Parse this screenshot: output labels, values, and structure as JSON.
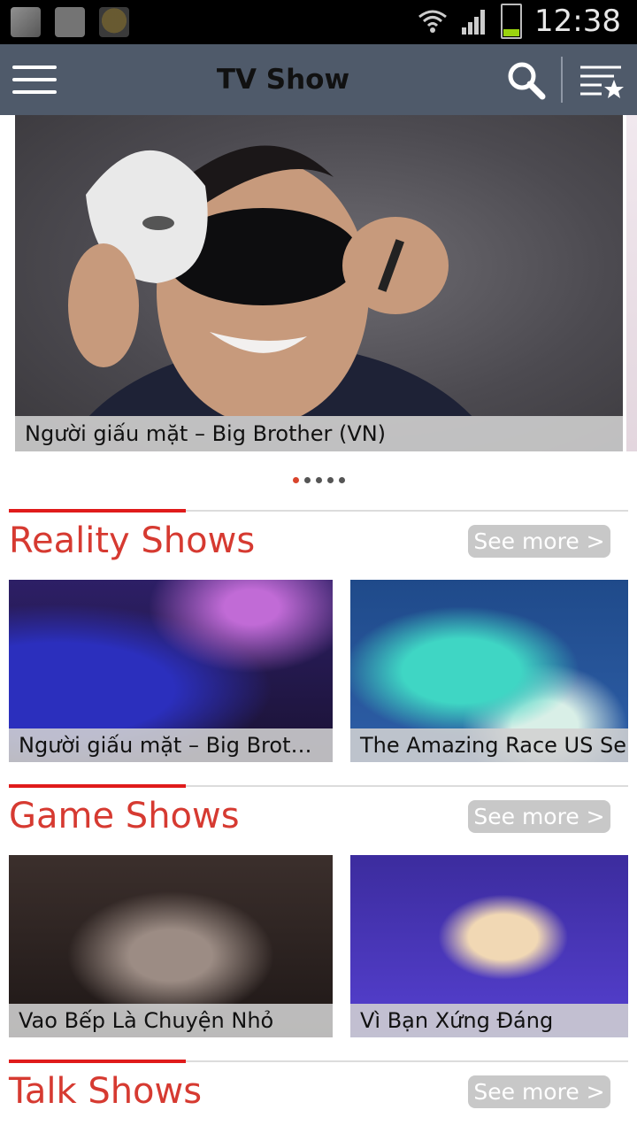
{
  "status_bar": {
    "time": "12:38"
  },
  "app_bar": {
    "title": "TV Show"
  },
  "featured": {
    "caption": "Người giấu mặt – Big Brother (VN)",
    "dot_count": 5,
    "active_index": 0
  },
  "sections": [
    {
      "title": "Reality Shows",
      "see_more": "See more >",
      "items": [
        {
          "caption": "Người giấu mặt – Big Brot…"
        },
        {
          "caption": "The Amazing Race US Se"
        }
      ]
    },
    {
      "title": "Game Shows",
      "see_more": "See more >",
      "items": [
        {
          "caption": "Vao Bếp Là Chuyện Nhỏ"
        },
        {
          "caption": "Vì Bạn Xứng Đáng"
        }
      ]
    },
    {
      "title": "Talk Shows",
      "see_more": "See more >",
      "items": []
    }
  ],
  "colors": {
    "app_bar": "#4f5a6a",
    "section_title": "#d63a31",
    "accent_rule": "#e01b1b",
    "see_more_bg": "#c8c8c8"
  }
}
